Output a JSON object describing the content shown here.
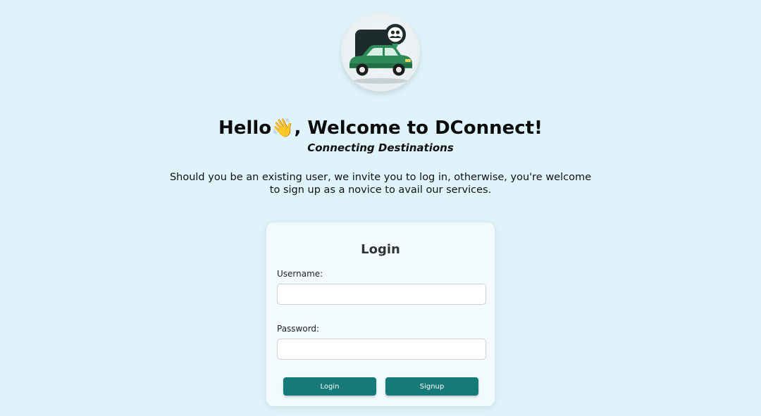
{
  "hero": {
    "logo_icon": "car-with-users-icon",
    "headline": "Hello👋, Welcome to DConnect!",
    "tagline": "Connecting Destinations",
    "intro": "Should you be an existing user, we invite you to log in, otherwise, you're welcome to sign up as a novice to avail our services."
  },
  "login_form": {
    "title": "Login",
    "username_label": "Username:",
    "username_value": "",
    "password_label": "Password:",
    "password_value": "",
    "login_button": "Login",
    "signup_button": "Signup"
  },
  "colors": {
    "background": "#dff3fb",
    "card": "#f3fafd",
    "button": "#157a78",
    "logo_green": "#1f7a4f"
  }
}
